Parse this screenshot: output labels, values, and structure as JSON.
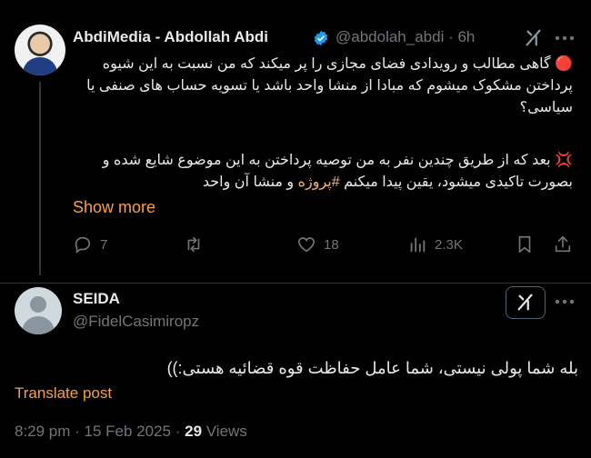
{
  "tweet": {
    "author_name": "AbdiMedia - Abdollah Abdi",
    "handle_time": "@abdolah_abdi · 6h",
    "text_para1": "🔴 گاهی مطالب و رویدادی فضای مجازی را پر میکند که من نسبت به این شیوه پرداختن مشکوک میشوم که مبادا از منشا واحد باشد یا تسویه حساب های صنفی یا سیاسی؟",
    "text_para2_before": "💢 بعد که از طریق چندین نفر به من توصیه پرداختن به این موضوع شایع شده و بصورت تاکیدی میشود، یقین پیدا میکنم ",
    "text_para2_hashtag": "#پروژه",
    "text_para2_after": " و منشا آن واحد",
    "show_more": "Show more",
    "actions": {
      "replies": "7",
      "retweets": "",
      "likes": "18",
      "views": "2.3K"
    }
  },
  "reply": {
    "author_name": "SEIDA",
    "handle": "@FidelCasimiropz",
    "text": "بله شما پولی نیستی، شما عامل حفاظت قوه قضائیه هستی:))",
    "translate": "Translate post",
    "timestamp": "8:29 pm · 15 Feb 2025 · ",
    "views_count": "29",
    "views_label": " Views"
  },
  "colors": {
    "background": "#000000",
    "text": "#e7e9ea",
    "muted": "#71767b",
    "accent": "#f7a04b",
    "verified": "#1d9bf0"
  },
  "icons": [
    "verified-badge-icon",
    "grok-icon",
    "more-icon",
    "reply-icon",
    "retweet-icon",
    "like-icon",
    "views-icon",
    "bookmark-icon",
    "share-icon"
  ]
}
